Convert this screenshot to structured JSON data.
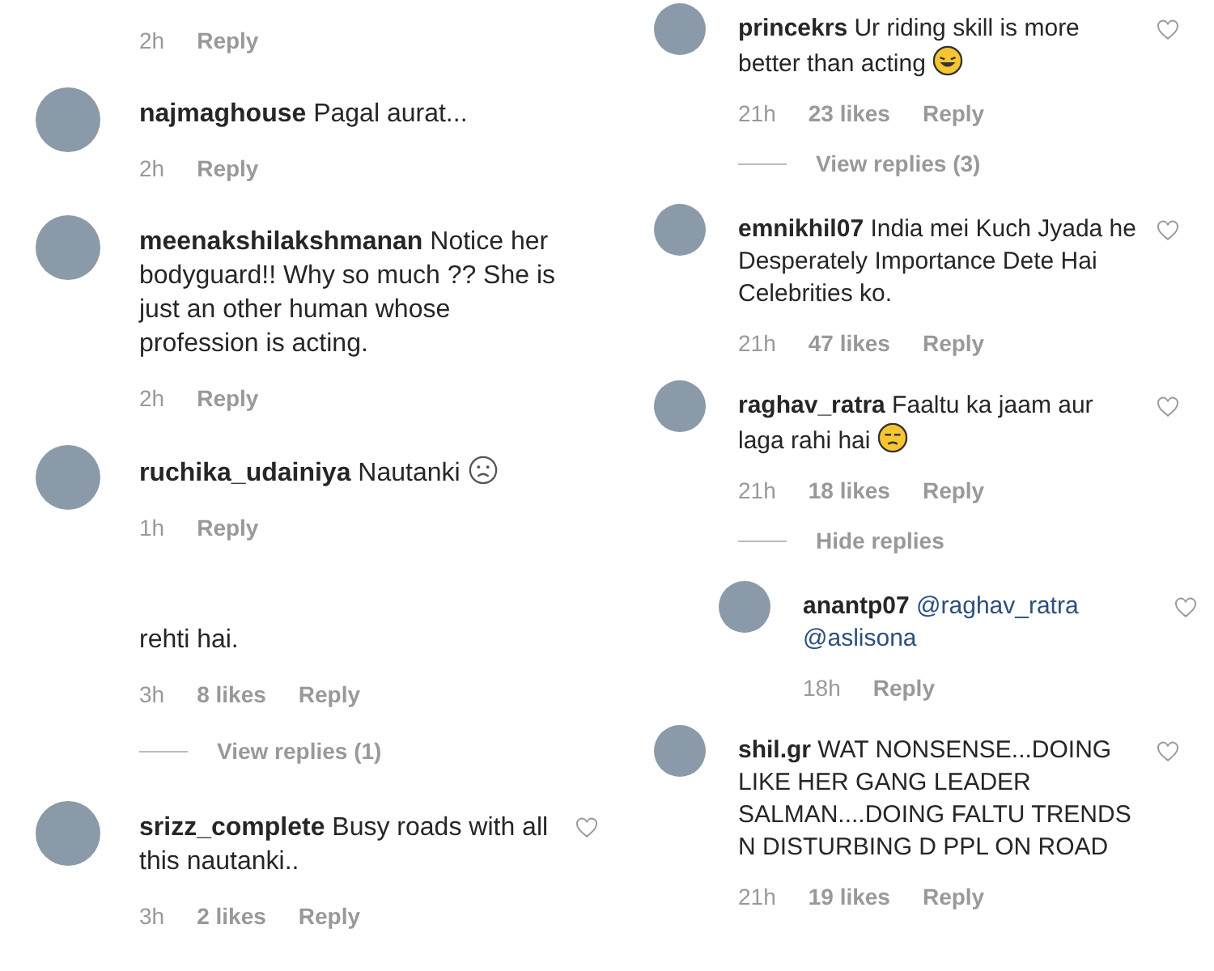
{
  "columns": [
    {
      "pieces": [
        {
          "items": [
            {
              "kind": "meta",
              "time": "2h",
              "reply": "Reply"
            },
            {
              "kind": "comment",
              "user": "najmaghouse",
              "text": "Pagal aurat...",
              "time": "2h",
              "reply": "Reply"
            },
            {
              "kind": "comment",
              "user": "meenakshilakshmanan",
              "text": "Notice her bodyguard!! Why so much ?? She is just an other human whose profession is acting.",
              "time": "2h",
              "reply": "Reply"
            },
            {
              "kind": "comment",
              "user": "ruchika_udainiya",
              "text": "Nautanki",
              "emoji": {
                "kind": "frown"
              },
              "time": "1h",
              "reply": "Reply"
            }
          ]
        },
        {
          "items": [
            {
              "kind": "tail",
              "text": "rehti hai.",
              "time": "3h",
              "likes": "8 likes",
              "reply": "Reply",
              "replies_toggle": "View replies (1)"
            },
            {
              "kind": "comment",
              "user": "srizz_complete",
              "text": "Busy roads with all this nautanki..",
              "heart": true,
              "time": "3h",
              "likes": "2 likes",
              "reply": "Reply"
            }
          ]
        }
      ]
    },
    {
      "pieces": [
        {
          "items": [
            {
              "kind": "comment",
              "user": "princekrs",
              "text": "Ur riding skill is more better than acting",
              "emoji": {
                "kind": "laughing"
              },
              "heart": true,
              "time": "21h",
              "likes": "23 likes",
              "reply": "Reply",
              "replies_toggle": "View replies (3)"
            },
            {
              "kind": "comment",
              "user": "emnikhil07",
              "text": "India mei Kuch Jyada he Desperately Importance Dete Hai Celebrities ko.",
              "heart": true,
              "time": "21h",
              "likes": "47 likes",
              "reply": "Reply"
            },
            {
              "kind": "comment",
              "user": "raghav_ratra",
              "text": "Faaltu ka jaam aur laga rahi hai",
              "emoji": {
                "kind": "unamused"
              },
              "heart": true,
              "time": "21h",
              "likes": "18 likes",
              "reply": "Reply",
              "replies_toggle": "Hide replies",
              "children": [
                {
                  "kind": "comment",
                  "user": "anantp07",
                  "mentions": [
                    "@raghav_ratra",
                    "@aslisona"
                  ],
                  "heart": true,
                  "time": "18h",
                  "reply": "Reply"
                }
              ]
            },
            {
              "kind": "comment",
              "user": "shil.gr",
              "text": "WAT NONSENSE...DOING LIKE HER GANG LEADER SALMAN....DOING FALTU TRENDS N DISTURBING D PPL ON ROAD",
              "heart": true,
              "time": "21h",
              "likes": "19 likes",
              "reply": "Reply"
            }
          ]
        }
      ]
    }
  ]
}
